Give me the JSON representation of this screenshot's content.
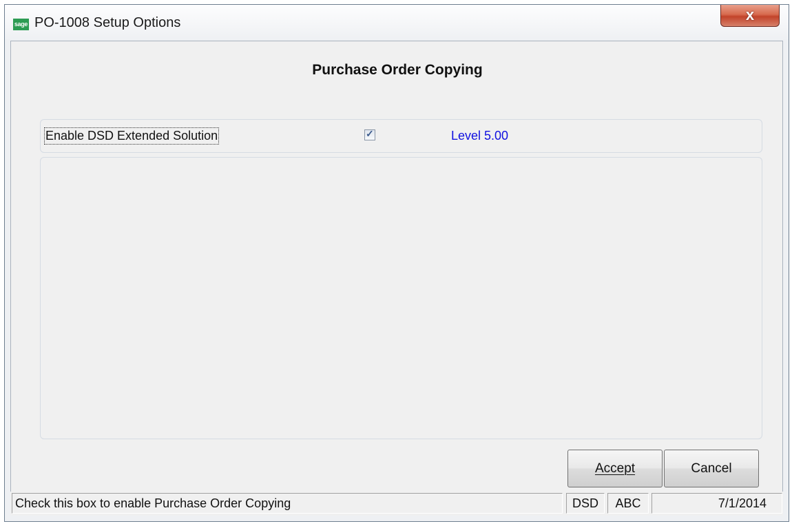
{
  "window": {
    "icon_text": "sage",
    "title": "PO-1008 Setup Options",
    "close_glyph": "x"
  },
  "main": {
    "heading": "Purchase Order Copying",
    "enable_label": "Enable DSD Extended Solution",
    "enable_checked": true,
    "checkbox_glyph": "✓",
    "level_text": "Level  5.00"
  },
  "buttons": {
    "accept_label": "Accept",
    "cancel_label": "Cancel"
  },
  "statusbar": {
    "message": "Check this box to enable Purchase Order Copying",
    "field1": "DSD",
    "field2": "ABC",
    "date": "7/1/2014"
  },
  "colors": {
    "level_text": "#1010e0",
    "app_icon": "#2d9c53",
    "close_button": "#c2432a"
  }
}
